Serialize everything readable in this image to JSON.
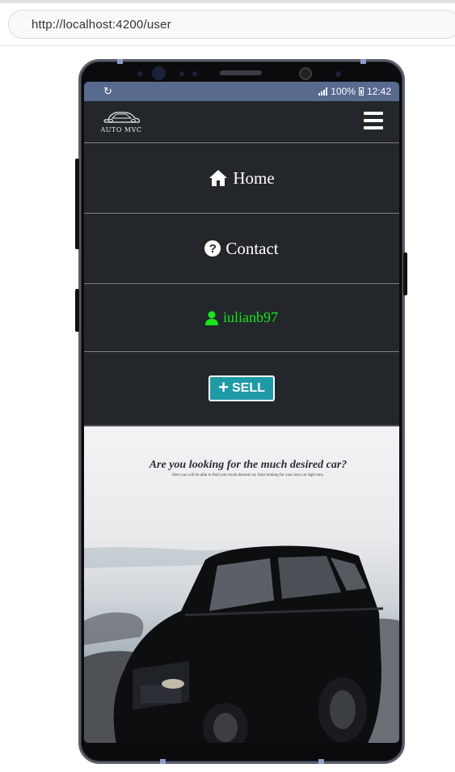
{
  "browser": {
    "url": "http://localhost:4200/user"
  },
  "status_bar": {
    "battery": "100%",
    "time": "12:42"
  },
  "navbar": {
    "logo_text": "AUTO MVC"
  },
  "menu": {
    "home": "Home",
    "contact": "Contact",
    "user": "iulianb97",
    "sell": "SELL"
  },
  "hero": {
    "title": "Are you looking for the much desired car?",
    "subtitle": "Here you will be able to find your much desired car. Start looking for your next car right now."
  },
  "colors": {
    "navbar_bg": "#23272b",
    "status_bar_bg": "#596a8f",
    "user_green": "#17e619",
    "sell_teal": "#1f9aa7"
  },
  "icons": [
    "home-icon",
    "question-circle-icon",
    "user-icon",
    "plus-icon",
    "hamburger-icon",
    "car-logo-icon"
  ]
}
